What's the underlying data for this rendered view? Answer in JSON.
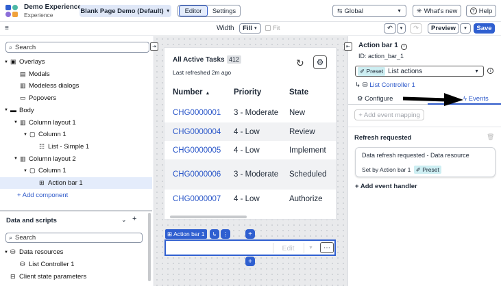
{
  "app": {
    "name": "Demo Experience",
    "subtitle": "Experience",
    "page_selector": "Blank Page Demo (Default)",
    "tabs": [
      "Editor",
      "Settings"
    ],
    "scope": "Global",
    "whats_new": "What's new",
    "help": "Help"
  },
  "toolbar": {
    "width_label": "Width",
    "width_value": "Fill",
    "fit_label": "Fit",
    "preview": "Preview",
    "save": "Save"
  },
  "left": {
    "search_placeholder": "Search",
    "tree": [
      {
        "label": "Overlays",
        "indent": 0,
        "expander": "▼",
        "icon": "overlay-icon"
      },
      {
        "label": "Modals",
        "indent": 1,
        "expander": "",
        "icon": "modal-icon"
      },
      {
        "label": "Modeless dialogs",
        "indent": 1,
        "expander": "",
        "icon": "modeless-icon"
      },
      {
        "label": "Popovers",
        "indent": 1,
        "expander": "",
        "icon": "popover-icon"
      },
      {
        "label": "Body",
        "indent": 0,
        "expander": "▼",
        "icon": "body-icon"
      },
      {
        "label": "Column layout 1",
        "indent": 1,
        "expander": "▼",
        "icon": "columns-icon"
      },
      {
        "label": "Column 1",
        "indent": 2,
        "expander": "▼",
        "icon": "column-icon"
      },
      {
        "label": "List - Simple 1",
        "indent": 3,
        "expander": "",
        "icon": "list-icon"
      },
      {
        "label": "Column layout 2",
        "indent": 1,
        "expander": "▼",
        "icon": "columns-icon"
      },
      {
        "label": "Column 1",
        "indent": 2,
        "expander": "▼",
        "icon": "column-icon"
      },
      {
        "label": "Action bar 1",
        "indent": 3,
        "expander": "",
        "icon": "actionbar-icon",
        "selected": true
      }
    ],
    "add_component": "+ Add component",
    "data_scripts": {
      "title": "Data and scripts",
      "search_placeholder": "Search",
      "items": [
        {
          "label": "Data resources",
          "indent": 0,
          "expander": "▼",
          "icon": "database-icon"
        },
        {
          "label": "List Controller 1",
          "indent": 1,
          "expander": "",
          "icon": "database-icon"
        },
        {
          "label": "Client state parameters",
          "indent": 0,
          "expander": "",
          "icon": "param-icon"
        }
      ]
    }
  },
  "canvas": {
    "list_title": "All Active Tasks",
    "count": "412",
    "refreshed": "Last refreshed 2m ago",
    "headers": [
      "Number",
      "Priority",
      "State"
    ],
    "rows": [
      {
        "number": "CHG0000001",
        "priority": "3 - Moderate",
        "state": "New"
      },
      {
        "number": "CHG0000004",
        "priority": "4 - Low",
        "state": "Review"
      },
      {
        "number": "CHG0000005",
        "priority": "4 - Low",
        "state": "Implement"
      },
      {
        "number": "CHG0000006",
        "priority": "3 - Moderate",
        "state": "Scheduled"
      },
      {
        "number": "CHG0000007",
        "priority": "4 - Low",
        "state": "Authorize"
      }
    ],
    "tag_label": "Action bar 1",
    "edit_label": "Edit"
  },
  "right": {
    "title": "Action bar 1",
    "id_line": "ID: action_bar_1",
    "preset_badge": "Preset",
    "preset_value": "List actions",
    "controller_link": "List Controller 1",
    "tabs": [
      "Configure",
      "Events"
    ],
    "add_mapping": "+ Add event mapping",
    "refresh_title": "Refresh requested",
    "event_title": "Data refresh requested - Data resource",
    "event_setby": "Set by Action bar 1",
    "event_badge": "Preset",
    "add_handler": "+ Add event handler"
  },
  "colors": {
    "accent": "#2c58c9",
    "save": "#2f5fd0",
    "selected": "#e4ecfb",
    "badge": "#cdeef2"
  }
}
